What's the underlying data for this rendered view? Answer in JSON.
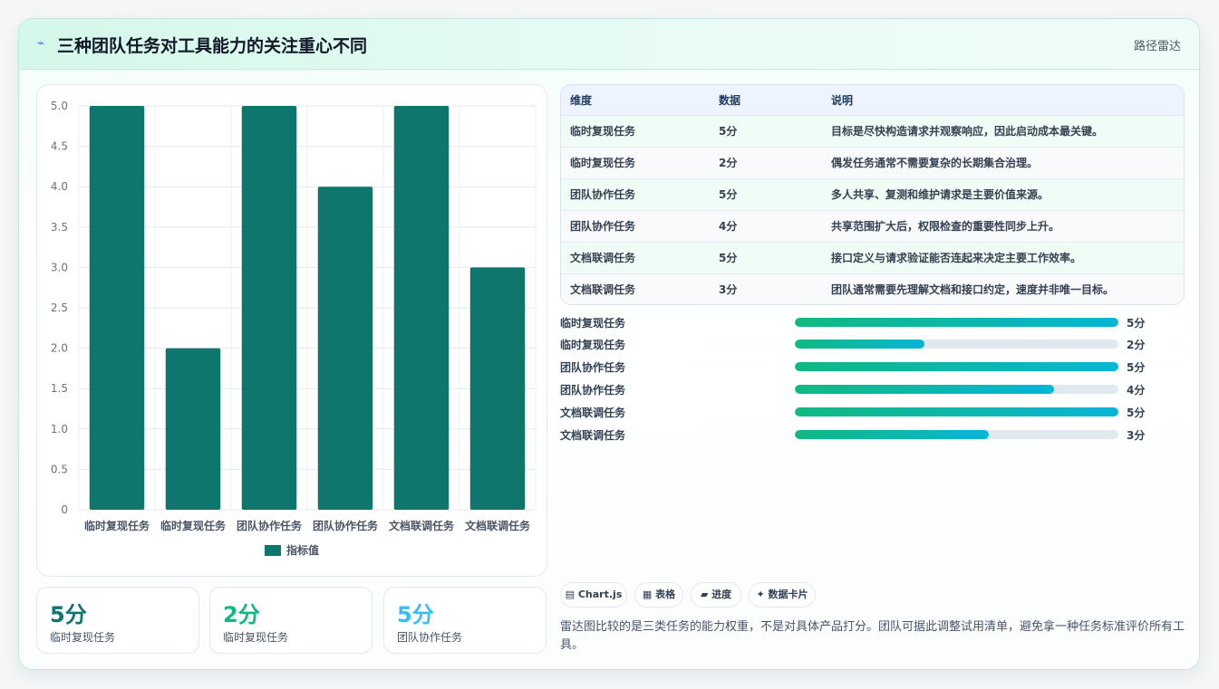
{
  "header": {
    "icon": "bolt-icon",
    "title": "三种团队任务对工具能力的关注重心不同",
    "tag": "路径雷达"
  },
  "chart_data": {
    "type": "bar",
    "categories": [
      "临时复现任务",
      "临时复现任务",
      "团队协作任务",
      "团队协作任务",
      "文档联调任务",
      "文档联调任务"
    ],
    "series": [
      {
        "name": "指标值",
        "values": [
          5,
          2,
          5,
          4,
          5,
          3
        ],
        "color": "#0f766e"
      }
    ],
    "ylim": [
      0,
      5
    ],
    "yticks": [
      "0",
      "0.5",
      "1.0",
      "1.5",
      "2.0",
      "2.5",
      "3.0",
      "3.5",
      "4.0",
      "4.5",
      "5.0"
    ],
    "grid": true,
    "legend": "bottom"
  },
  "kpis": [
    {
      "value": "5分",
      "label": "临时复现任务",
      "color": "#0f766e"
    },
    {
      "value": "2分",
      "label": "临时复现任务",
      "color": "#10b981"
    },
    {
      "value": "5分",
      "label": "团队协作任务",
      "color": "#38bdf8"
    }
  ],
  "table": {
    "headers": [
      "维度",
      "数据",
      "说明"
    ],
    "rows": [
      [
        "临时复现任务",
        "5分",
        "目标是尽快构造请求并观察响应，因此启动成本最关键。"
      ],
      [
        "临时复现任务",
        "2分",
        "偶发任务通常不需要复杂的长期集合治理。"
      ],
      [
        "团队协作任务",
        "5分",
        "多人共享、复测和维护请求是主要价值来源。"
      ],
      [
        "团队协作任务",
        "4分",
        "共享范围扩大后，权限检查的重要性同步上升。"
      ],
      [
        "文档联调任务",
        "5分",
        "接口定义与请求验证能否连起来决定主要工作效率。"
      ],
      [
        "文档联调任务",
        "3分",
        "团队通常需要先理解文档和接口约定，速度并非唯一目标。"
      ]
    ]
  },
  "progress": {
    "max": 5,
    "items": [
      {
        "label": "临时复现任务",
        "value": 5,
        "text": "5分"
      },
      {
        "label": "临时复现任务",
        "value": 2,
        "text": "2分"
      },
      {
        "label": "团队协作任务",
        "value": 5,
        "text": "5分"
      },
      {
        "label": "团队协作任务",
        "value": 4,
        "text": "4分"
      },
      {
        "label": "文档联调任务",
        "value": 5,
        "text": "5分"
      },
      {
        "label": "文档联调任务",
        "value": 3,
        "text": "3分"
      }
    ]
  },
  "chips": [
    {
      "icon": "chart-icon",
      "glyph": "▤",
      "label": "Chart.js"
    },
    {
      "icon": "table-icon",
      "glyph": "▦",
      "label": "表格"
    },
    {
      "icon": "progress-icon",
      "glyph": "▰",
      "label": "进度"
    },
    {
      "icon": "sparkle-icon",
      "glyph": "✦",
      "label": "数据卡片"
    }
  ],
  "note": "雷达图比较的是三类任务的能力权重，不是对具体产品打分。团队可据此调整试用清单，避免拿一种任务标准评价所有工具。"
}
